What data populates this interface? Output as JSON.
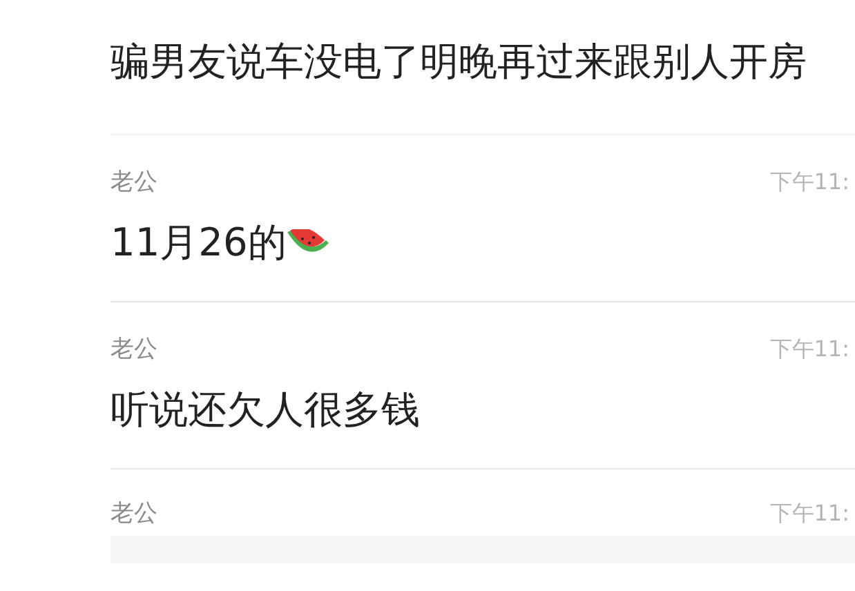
{
  "messages": [
    {
      "text": "骗男友说车没电了明晚再过来跟别人开房",
      "emoji": false
    },
    {
      "sender": "老公",
      "time": "下午11:",
      "text": "11月26的",
      "emoji": true
    },
    {
      "sender": "老公",
      "time": "下午11:",
      "text": "听说还欠人很多钱",
      "emoji": false
    },
    {
      "sender": "老公",
      "time": "下午11:"
    }
  ]
}
